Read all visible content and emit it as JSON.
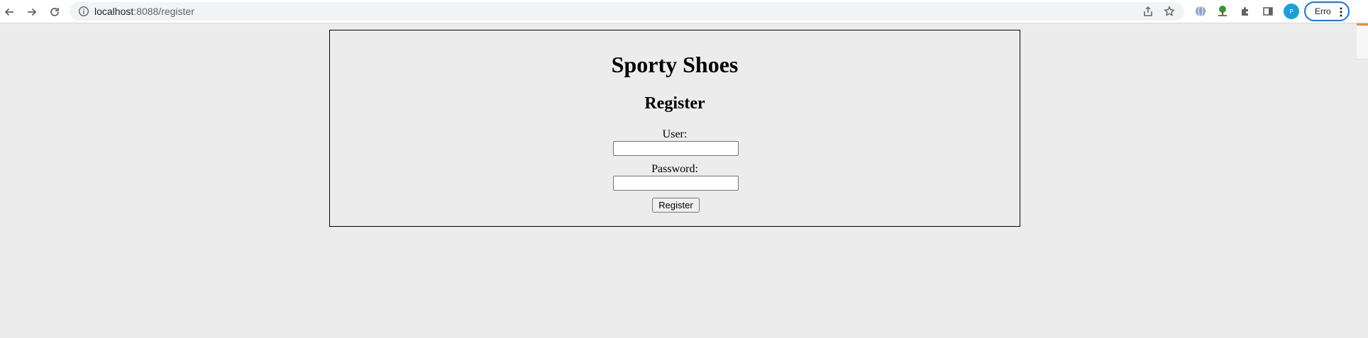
{
  "browser": {
    "url_host": "localhost",
    "url_rest": ":8088/register",
    "profile_label": "Erro",
    "profile_initial": "P"
  },
  "page": {
    "title": "Sporty Shoes",
    "subtitle": "Register",
    "user_label": "User:",
    "user_value": "",
    "password_label": "Password:",
    "password_value": "",
    "submit_label": "Register"
  },
  "colors": {
    "page_background": "#ececec",
    "chip_border": "#1a73e8",
    "profile_dot": "#1a9fdb",
    "side_accent": "#f28b2b"
  }
}
